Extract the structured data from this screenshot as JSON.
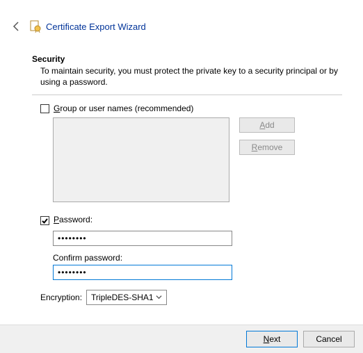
{
  "header": {
    "title": "Certificate Export Wizard"
  },
  "section": {
    "heading": "Security",
    "subtext": "To maintain security, you must protect the private key to a security principal or by using a password."
  },
  "group_option": {
    "checked": false,
    "label": "Group or user names (recommended)"
  },
  "buttons": {
    "add": "Add",
    "remove": "Remove"
  },
  "password_option": {
    "checked": true,
    "label": "Password:",
    "value": "••••••••",
    "confirm_label": "Confirm password:",
    "confirm_value": "••••••••"
  },
  "encryption": {
    "label": "Encryption:",
    "selected": "TripleDES-SHA1"
  },
  "footer": {
    "next": "Next",
    "cancel": "Cancel"
  }
}
